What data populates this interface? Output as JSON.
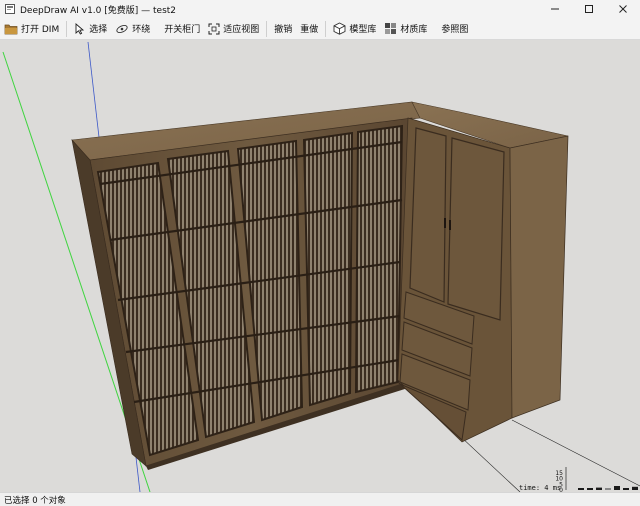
{
  "window": {
    "title": "DeepDraw AI v1.0 [免费版] — test2",
    "controls": [
      "minimize-icon",
      "maximize-icon",
      "close-icon"
    ]
  },
  "toolbar": {
    "open_dim": "打开 DIM",
    "select": "选择",
    "orbit": "环绕",
    "toggle_doors": "开关柜门",
    "fit_view": "适应视图",
    "undo": "撤销",
    "redo": "重做",
    "model_library": "模型库",
    "material_library": "材质库",
    "reference_image": "参照图"
  },
  "perf_overlay": {
    "y_ticks": [
      "20",
      "15",
      "10",
      "5",
      "0"
    ],
    "label": "time: 4 ms",
    "bars": [
      0.05,
      0.05,
      0.15,
      0.05,
      0.25,
      0.05,
      0.2
    ]
  },
  "status": {
    "text": "已选择 0 个对象"
  }
}
